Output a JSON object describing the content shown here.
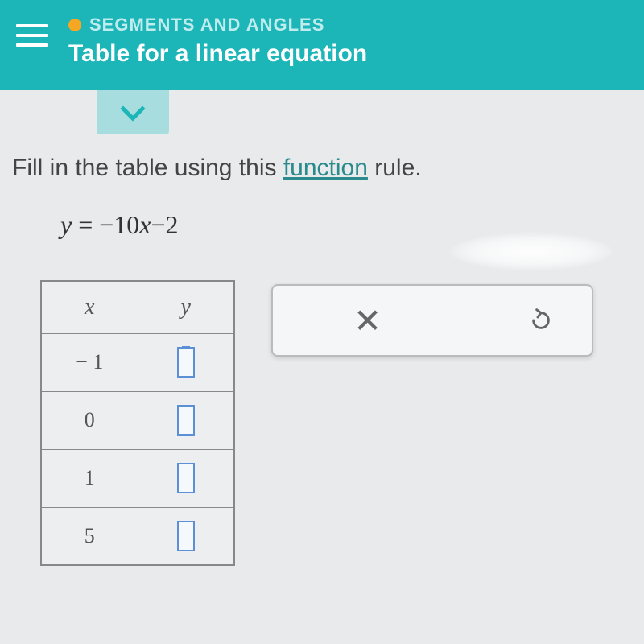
{
  "header": {
    "section": "SEGMENTS AND ANGLES",
    "title": "Table for a linear equation"
  },
  "content": {
    "instruction_prefix": "Fill in the table using this ",
    "function_link": "function",
    "instruction_suffix": " rule.",
    "equation_y": "y",
    "equation_eq": " = ",
    "equation_neg": "−",
    "equation_coef": "10",
    "equation_x": "x",
    "equation_const": "−2"
  },
  "table": {
    "header_x": "x",
    "header_y": "y",
    "rows": [
      {
        "x": "− 1"
      },
      {
        "x": "0"
      },
      {
        "x": "1"
      },
      {
        "x": "5"
      }
    ]
  },
  "toolbar": {
    "clear_symbol": "✕"
  }
}
